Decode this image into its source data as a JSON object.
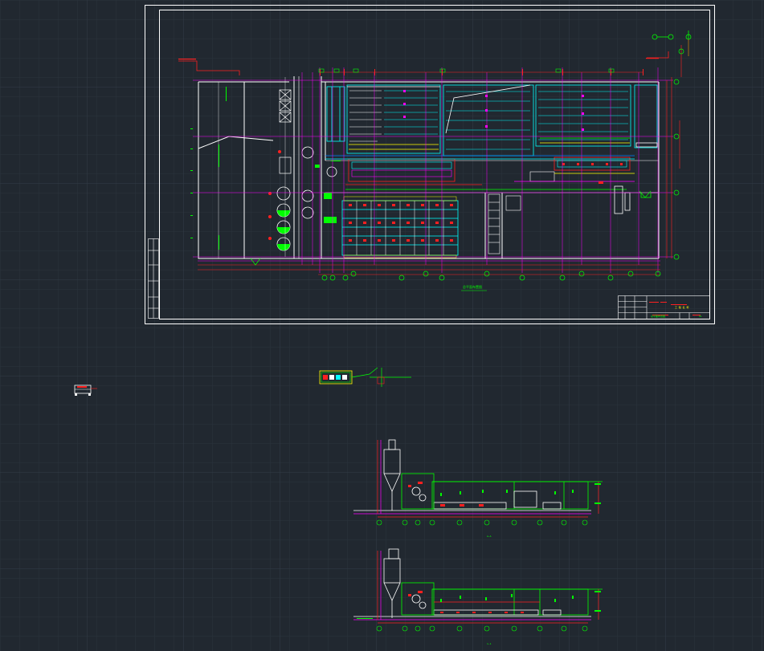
{
  "viewport": {
    "background": "#212830",
    "grid_color": "#2b333d",
    "grid_major_color": "#333c47"
  },
  "palette": {
    "border": "#ffffff",
    "wall": "#ffffff",
    "axis": "#ff00ff",
    "dimension": "#ff2020",
    "equipment": "#00ffff",
    "annotation": "#00ff00",
    "detail": "#ffff00",
    "piping": "#0080ff"
  },
  "drawing": {
    "plan_caption": "总平面布置图",
    "section_1_caption": "A—A",
    "section_2_caption": "1—1"
  },
  "title_block": {
    "rows": [
      "设 计",
      "校 对",
      "审 核",
      "批 准"
    ],
    "project": "工 程 名 称",
    "sheet": "总平面布置图",
    "number": "01"
  },
  "axis_labels": {
    "plan_bottom": [
      "1",
      "2",
      "3",
      "4",
      "5",
      "6",
      "7",
      "8",
      "9",
      "10",
      "11",
      "12",
      "13",
      "14",
      "15"
    ],
    "plan_right": [
      "A",
      "B",
      "C",
      "D"
    ],
    "section_1": [
      "1",
      "2",
      "3",
      "4",
      "5",
      "6",
      "7",
      "8",
      "9",
      "10",
      "11"
    ],
    "section_2": [
      "1",
      "2",
      "3",
      "4",
      "5",
      "6",
      "7",
      "8",
      "9",
      "10",
      "11"
    ]
  },
  "icons": {
    "north_arrow": "north-arrow-icon",
    "tank": "tank-icon"
  }
}
